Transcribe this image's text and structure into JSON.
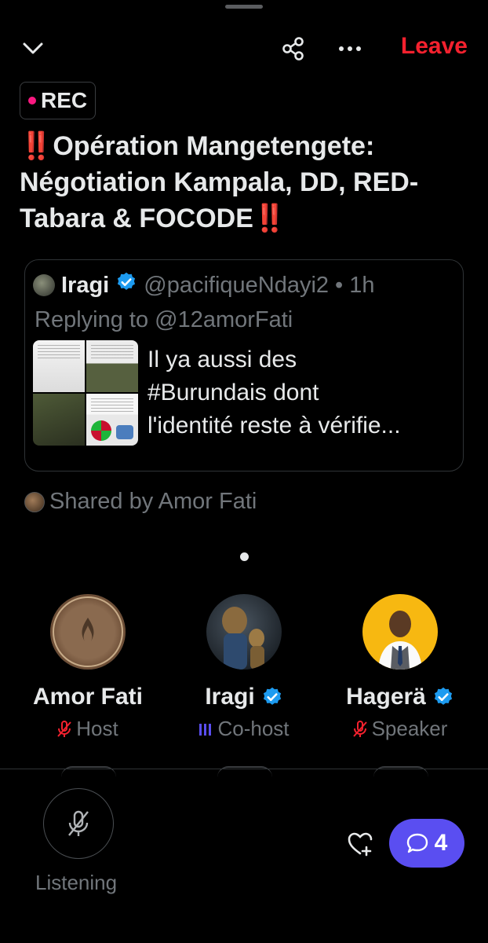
{
  "header": {
    "collapse_icon": "chevron-down-icon",
    "share_icon": "share-icon",
    "more_icon": "more-horizontal-icon",
    "leave_label": "Leave",
    "leave_color": "#f4212e"
  },
  "recording": {
    "label": "REC",
    "dot_color": "#f91880"
  },
  "space": {
    "title_emoji_start": "‼️",
    "title_text": "Opération Mangetengete: Négotiation Kampala, DD, RED-Tabara & FOCODE",
    "title_emoji_end": "‼️"
  },
  "pinned_post": {
    "author_name": "Iragi",
    "handle": "@pacifiqueNdayi2",
    "separator": "•",
    "time": "1h",
    "replying_to": "Replying to @12amorFati",
    "text_lines": [
      "Il ya aussi des",
      "#Burundais dont",
      "l'identité reste à vérifie..."
    ]
  },
  "shared_by": "Shared by Amor Fati",
  "speakers": [
    {
      "name": "Amor Fati",
      "role": "Host",
      "verified": false,
      "mic_state": "muted"
    },
    {
      "name": "Iragi",
      "role": "Co-host",
      "verified": true,
      "mic_state": "speaking"
    },
    {
      "name": "Hagerä",
      "role": "Speaker",
      "verified": true,
      "mic_state": "muted"
    }
  ],
  "bottom_bar": {
    "mic_icon": "mic-off-icon",
    "listening_label": "Listening",
    "heart_icon": "heart-plus-icon",
    "comment_icon": "comment-icon",
    "comment_count": "4",
    "accent": "#5a4ef1"
  },
  "colors": {
    "verified": "#1d9bf0",
    "muted_mic": "#f4212e",
    "speaking_bars": "#5a4ef1"
  }
}
